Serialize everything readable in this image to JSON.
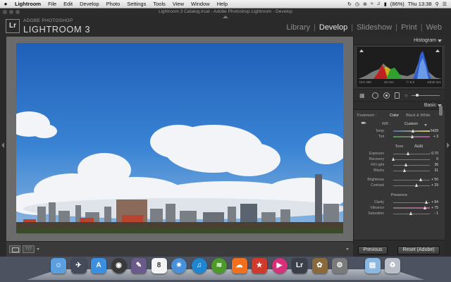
{
  "menubar": {
    "apple": "",
    "app": "Lightroom",
    "items": [
      "File",
      "Edit",
      "Develop",
      "Photo",
      "Settings",
      "Tools",
      "View",
      "Window",
      "Help"
    ],
    "battery": "(86%)",
    "clock": "Thu 13:38"
  },
  "window": {
    "title": "Lightroom 3 Catalog.lrcat - Adobe Photoshop Lightroom - Develop"
  },
  "header": {
    "logo": "Lr",
    "brand_small": "ADOBE PHOTOSHOP",
    "brand_big": "LIGHTROOM 3",
    "modules": [
      "Library",
      "Develop",
      "Slideshow",
      "Print",
      "Web"
    ],
    "active_module": "Develop"
  },
  "histogram": {
    "title": "Histogram",
    "iso": "ISO 400",
    "focal": "16 mm",
    "aperture": "f / 8.0",
    "shutter": "1/640 sec"
  },
  "basic": {
    "title": "Basic",
    "treatment_label": "Treatment :",
    "treatment_color": "Color",
    "treatment_bw": "Black & White",
    "wb_label": "WB :",
    "wb_value": "Custom",
    "tone_label": "Tone",
    "auto_label": "Auto",
    "presence_label": "Presence",
    "wb_sliders": [
      {
        "label": "Temp",
        "value": "5428",
        "pos": 0.55,
        "kind": "temp"
      },
      {
        "label": "Tint",
        "value": "+ 3",
        "pos": 0.52,
        "kind": "tint"
      }
    ],
    "tone_sliders": [
      {
        "label": "Exposure",
        "value": "- 0.70",
        "pos": 0.42
      },
      {
        "label": "Recovery",
        "value": "0",
        "pos": 0.0
      },
      {
        "label": "Fill Light",
        "value": "36",
        "pos": 0.36
      },
      {
        "label": "Blacks",
        "value": "31",
        "pos": 0.31
      }
    ],
    "tone_sliders2": [
      {
        "label": "Brightness",
        "value": "+ 50",
        "pos": 0.75
      },
      {
        "label": "Contrast",
        "value": "+ 29",
        "pos": 0.64
      }
    ],
    "presence_sliders": [
      {
        "label": "Clarity",
        "value": "+ 84",
        "pos": 0.92,
        "kind": ""
      },
      {
        "label": "Vibrance",
        "value": "+ 75",
        "pos": 0.87,
        "kind": "vib"
      },
      {
        "label": "Saturation",
        "value": "- 1",
        "pos": 0.49,
        "kind": ""
      }
    ]
  },
  "buttons": {
    "previous": "Previous",
    "reset": "Reset (Adobe)"
  },
  "toolbar": {
    "compare": "Y|Y"
  },
  "dock": {
    "icons": [
      {
        "name": "finder-icon",
        "color": "#5aa0e0",
        "glyph": "☺"
      },
      {
        "name": "launchpad-icon",
        "color": "#444a5a",
        "glyph": "✈"
      },
      {
        "name": "app-store-icon",
        "color": "#3b8fe0",
        "glyph": "A"
      },
      {
        "name": "facetime-icon",
        "color": "#3a3a3a",
        "glyph": "◉"
      },
      {
        "name": "photo-booth-icon",
        "color": "#6a5a8a",
        "glyph": "✎"
      },
      {
        "name": "calendar-icon",
        "color": "#f4f4f4",
        "glyph": "8",
        "dark": true
      },
      {
        "name": "safari-icon",
        "color": "#4a90d8",
        "glyph": "✷"
      },
      {
        "name": "itunes-icon",
        "color": "#1e86d0",
        "glyph": "♫"
      },
      {
        "name": "spotify-icon",
        "color": "#4c9a2a",
        "glyph": "≋"
      },
      {
        "name": "soundcloud-icon",
        "color": "#f0701e",
        "glyph": "☁"
      },
      {
        "name": "app-red-icon",
        "color": "#d03a2a",
        "glyph": "★"
      },
      {
        "name": "media-player-icon",
        "color": "#d8307a",
        "glyph": "▶"
      },
      {
        "name": "lightroom-icon",
        "color": "#3a3f48",
        "glyph": "Lr"
      },
      {
        "name": "iphoto-icon",
        "color": "#8a6a3a",
        "glyph": "✿"
      },
      {
        "name": "system-preferences-icon",
        "color": "#7a7a7a",
        "glyph": "⚙"
      },
      {
        "name": "downloads-folder-icon",
        "color": "#8ab8e0",
        "glyph": "▤"
      },
      {
        "name": "trash-icon",
        "color": "#b8bec8",
        "glyph": "♻"
      }
    ]
  },
  "colors": {
    "panel": "#363636",
    "sky": "#2b6fc4",
    "accent_text": "#e6e6e6"
  }
}
